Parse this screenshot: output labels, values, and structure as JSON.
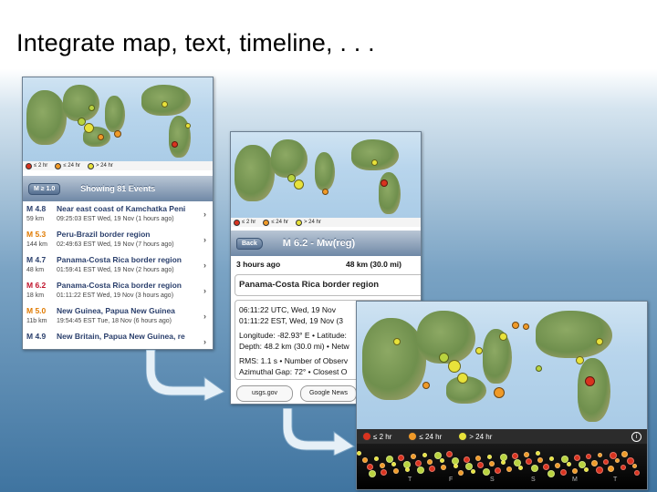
{
  "slide": {
    "title": "Integrate map, text, timeline, . . ."
  },
  "legend": {
    "hour": "≤ 2 hr",
    "day": "≤ 24 hr",
    "older": "> 24 hr"
  },
  "list_screen": {
    "filter_button": "M ≥ 1.0",
    "header": "Showing 81 Events",
    "events": [
      {
        "mag": "M 4.8",
        "place": "Near east coast of Kamchatka Peni",
        "dist": "59 km",
        "time": "09:25:03 EST Wed, 19 Nov (1 hours ago)",
        "color": "#2a3f6c"
      },
      {
        "mag": "M 5.3",
        "place": "Peru-Brazil border region",
        "dist": "144 km",
        "time": "02:49:63 EST Wed, 19 Nov (7 hours ago)",
        "color": "#e07a00"
      },
      {
        "mag": "M 4.7",
        "place": "Panama-Costa Rica border region",
        "dist": "48 km",
        "time": "01:59:41 EST Wed, 19 Nov (2 hours ago)",
        "color": "#2a3f6c"
      },
      {
        "mag": "M 6.2",
        "place": "Panama-Costa Rica border region",
        "dist": "18 km",
        "time": "01:11:22 EST Wed, 19 Nov (3 hours ago)",
        "color": "#c0142c"
      },
      {
        "mag": "M 5.0",
        "place": "New Guinea, Papua New Guinea",
        "dist": "11b km",
        "time": "19:54:45 EST Tue, 18 Nov (6 hours ago)",
        "color": "#e07a00"
      },
      {
        "mag": "M 4.9",
        "place": "New Britain, Papua New Guinea, re",
        "dist": "",
        "time": "",
        "color": "#2a3f6c"
      }
    ]
  },
  "detail_screen": {
    "back_button": "Back",
    "title": "M 6.2 - Mw(reg)",
    "ago": "3 hours ago",
    "distance": "48 km (30.0 mi)",
    "region": "Panama-Costa Rica border region",
    "lines": [
      "06:11:22 UTC, Wed, 19 Nov",
      "01:11:22 EST, Wed, 19 Nov (3",
      "Longitude: -82.93° E • Latitude:",
      "Depth: 48.2 km (30.0 mi) • Netw",
      "RMS: 1.1 s • Number of Observ",
      "Azimuthal Gap: 72° • Closest O"
    ],
    "link_usgs": "usgs.gov",
    "link_news": "Google News"
  },
  "timeline": {
    "days": [
      "T",
      "F",
      "S",
      "S",
      "M",
      "T"
    ]
  },
  "colors": {
    "accent_title": "#2a3f6c",
    "hour_red": "#d9331f",
    "day_orange": "#f09a28",
    "older_yellow": "#e8e23a"
  },
  "icons": [
    "chevron-right-icon",
    "arrow-curved-icon",
    "info-icon"
  ]
}
